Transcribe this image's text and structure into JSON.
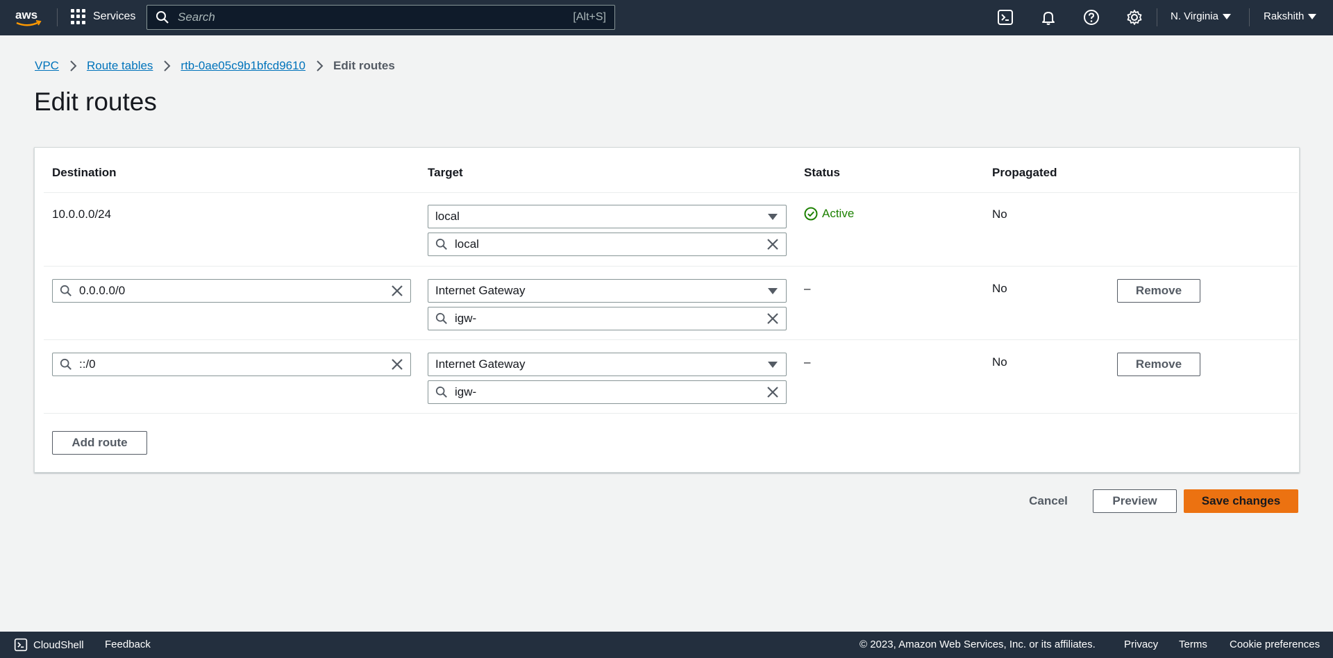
{
  "topnav": {
    "logo_text": "aws",
    "services_label": "Services",
    "search_placeholder": "Search",
    "search_shortcut": "[Alt+S]",
    "region": "N. Virginia",
    "user": "Rakshith"
  },
  "breadcrumb": {
    "items": [
      "VPC",
      "Route tables",
      "rtb-0ae05c9b1bfcd9610"
    ],
    "current": "Edit routes"
  },
  "page": {
    "title": "Edit routes"
  },
  "table": {
    "headers": {
      "destination": "Destination",
      "target": "Target",
      "status": "Status",
      "propagated": "Propagated"
    },
    "rows": [
      {
        "destination": "10.0.0.0/24",
        "target_type": "local",
        "target_filter": "local",
        "status": "Active",
        "propagated": "No"
      },
      {
        "destination": "0.0.0.0/0",
        "target_type": "Internet Gateway",
        "target_filter": "igw-",
        "status": "–",
        "propagated": "No",
        "remove_label": "Remove"
      },
      {
        "destination": "::/0",
        "target_type": "Internet Gateway",
        "target_filter": "igw-",
        "status": "–",
        "propagated": "No",
        "remove_label": "Remove"
      }
    ],
    "add_route_label": "Add route"
  },
  "actions": {
    "cancel": "Cancel",
    "preview": "Preview",
    "save": "Save changes"
  },
  "footer": {
    "cloudshell": "CloudShell",
    "feedback": "Feedback",
    "copyright": "© 2023, Amazon Web Services, Inc. or its affiliates.",
    "privacy": "Privacy",
    "terms": "Terms",
    "cookies": "Cookie preferences"
  },
  "colors": {
    "nav_bg": "#232f3e",
    "link": "#0073bb",
    "primary": "#ec7211",
    "success": "#1d8102"
  }
}
